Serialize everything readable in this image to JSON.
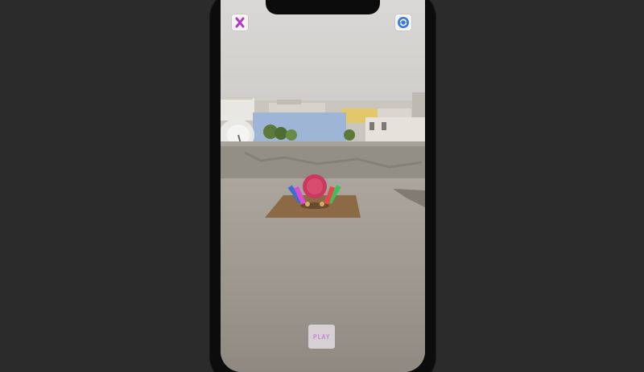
{
  "toolbar": {
    "close_icon": "close-icon",
    "close_color": "#b23bbf",
    "switch_icon": "camera-switch-icon",
    "switch_color": "#3a7bd5"
  },
  "play_button": {
    "label": "PLAY",
    "color": "#c98ad0"
  },
  "scene": {
    "mat_color": "#8c6a45",
    "disc_color": "#c93a5e"
  }
}
